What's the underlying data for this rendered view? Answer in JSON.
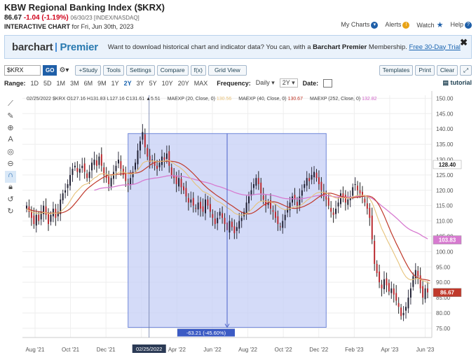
{
  "header": {
    "title": "KBW Regional Banking Index ($KRX)",
    "price": "86.67",
    "change": "-1.04 (-1.19%)",
    "meta": "06/30/23 [INDEX/NASDAQ]",
    "chart_label": "INTERACTIVE CHART",
    "chart_date": "for Fri, Jun 30th, 2023",
    "links": [
      "My Charts",
      "Alerts",
      "Watch",
      "Help"
    ]
  },
  "banner": {
    "logo_a": "barchart",
    "logo_b": "Premier",
    "msg_a": "Want to download historical chart and indicator data? You can, with a",
    "msg_b": "Barchart Premier",
    "msg_c": "Membership.",
    "link": "Free 30-Day Trial",
    "close": "✖"
  },
  "toolbar": {
    "symbol": "$KRX",
    "go": "GO",
    "gear": "⚙▾",
    "buttons": [
      "+Study",
      "Tools",
      "Settings",
      "Compare",
      "f(x)",
      "Grid View"
    ],
    "right_buttons": [
      "Templates",
      "Print",
      "Clear",
      "⤢"
    ]
  },
  "range": {
    "label": "Range:",
    "options": [
      "1D",
      "5D",
      "1M",
      "3M",
      "6M",
      "9M",
      "1Y",
      "2Y",
      "3Y",
      "5Y",
      "10Y",
      "20Y",
      "MAX"
    ],
    "selected": "2Y",
    "frequency_label": "Frequency:",
    "frequency": "Daily",
    "period": "2Y",
    "date_label": "Date:",
    "tutorial": "tutorial"
  },
  "legend": {
    "ohlc": "02/25/2022 $KRX O127.16 H131.83 L127.16 C131.61 ▲5.51",
    "ma20": "MAEXP (20, Close, 0)",
    "ma20_val": "130.56",
    "ma40": "MAEXP (40, Close, 0)",
    "ma40_val": "130.67",
    "ma252": "MAEXP (252, Close, 0)",
    "ma252_val": "132.82"
  },
  "chart_data": {
    "type": "candlestick",
    "y_ticks": [
      150,
      145,
      140,
      135,
      130,
      125,
      120,
      115,
      110,
      105,
      100,
      95,
      90,
      85,
      80,
      75
    ],
    "x_ticks": [
      "Aug '21",
      "Oct '21",
      "Dec '21",
      "Feb '22",
      "Apr '22",
      "Jun '22",
      "Aug '22",
      "Oct '22",
      "Dec '22",
      "Feb '23",
      "Apr '23",
      "Jun '23"
    ],
    "ylim": [
      72,
      151
    ],
    "last_price": "86.67",
    "ma_badge_1": "128.40",
    "ma_badge_2": "103.83",
    "cursor_date": "02/25/2022",
    "measure_label": "-63.21 (-45.60%)",
    "measure_start": 138.5,
    "measure_end": 75.3,
    "closes": [
      115,
      113,
      111,
      109,
      112,
      110,
      113,
      115,
      112,
      109,
      112,
      114,
      111,
      113,
      117,
      119,
      120,
      122,
      125,
      127,
      128,
      126,
      127,
      128,
      126,
      124,
      126,
      129,
      130,
      128,
      131,
      128,
      125,
      124,
      122,
      124,
      126,
      128,
      130,
      127,
      125,
      123,
      122,
      124,
      126,
      129,
      133,
      136,
      139,
      134,
      131,
      129,
      130,
      128,
      127,
      129,
      131,
      130,
      132,
      128,
      125,
      124,
      122,
      124,
      121,
      120,
      118,
      116,
      117,
      115,
      114,
      116,
      114,
      113,
      117,
      115,
      113,
      111,
      109,
      111,
      113,
      111,
      109,
      107,
      110,
      108,
      106,
      108,
      110,
      111,
      113,
      116,
      118,
      120,
      122,
      124,
      122,
      119,
      117,
      115,
      116,
      114,
      113,
      111,
      109,
      108,
      110,
      112,
      114,
      116,
      118,
      117,
      115,
      118,
      120,
      122,
      124,
      123,
      125,
      126,
      124,
      122,
      120,
      118,
      117,
      115,
      113,
      112,
      114,
      116,
      119,
      118,
      116,
      117,
      118,
      121,
      122,
      120,
      119,
      118,
      116,
      114,
      111,
      104,
      96,
      93,
      90,
      88,
      91,
      89,
      87,
      88,
      86,
      84,
      82,
      79,
      80,
      82,
      85,
      88,
      92,
      94,
      92,
      88,
      85,
      88,
      86.7
    ],
    "ma20": [
      114,
      113.5,
      113,
      112.7,
      112.6,
      112.4,
      112.5,
      112.8,
      112.7,
      112.4,
      112.4,
      112.6,
      112.5,
      112.6,
      113,
      113.7,
      114.4,
      115.3,
      116.5,
      117.8,
      119,
      119.8,
      120.6,
      121.4,
      121.9,
      122.1,
      122.6,
      123.3,
      124,
      124.4,
      125.1,
      125.4,
      125.4,
      125.3,
      125,
      124.9,
      125,
      125.3,
      125.8,
      126,
      125.9,
      125.7,
      125.4,
      125.3,
      125.4,
      125.8,
      126.6,
      127.6,
      128.8,
      129.3,
      129.5,
      129.5,
      129.6,
      129.5,
      129.3,
      129.3,
      129.5,
      129.5,
      129.8,
      129.6,
      129.2,
      128.7,
      128.1,
      127.7,
      127.1,
      126.4,
      125.6,
      124.6,
      123.8,
      122.8,
      121.9,
      121.2,
      120.4,
      119.6,
      119.3,
      118.9,
      118.4,
      117.7,
      116.9,
      116.4,
      116.1,
      115.6,
      115,
      114.3,
      113.9,
      113.3,
      112.6,
      112.2,
      112,
      111.9,
      112,
      112.4,
      113,
      113.7,
      114.5,
      115.4,
      116.1,
      116.4,
      116.5,
      116.4,
      116.4,
      116.2,
      115.9,
      115.5,
      114.9,
      114.3,
      113.9,
      113.7,
      113.8,
      114,
      114.4,
      114.6,
      114.6,
      114.9,
      115.4,
      116,
      116.7,
      117.2,
      117.9,
      118.6,
      119.1,
      119.3,
      119.4,
      119.3,
      119.1,
      118.8,
      118.3,
      117.8,
      117.5,
      117.4,
      117.6,
      117.6,
      117.5,
      117.5,
      117.5,
      117.8,
      118.1,
      118.3,
      118.4,
      118.4,
      118.2,
      117.9,
      117.3,
      116,
      114,
      111.8,
      109.6,
      107.5,
      105.9,
      104.2,
      102.6,
      101.1,
      99.5,
      97.9,
      96.3,
      94.5,
      93,
      91.8,
      91.1,
      90.8,
      90.9,
      91.2,
      91.3,
      91,
      90.5,
      90.3,
      89.9,
      89.6
    ]
  }
}
